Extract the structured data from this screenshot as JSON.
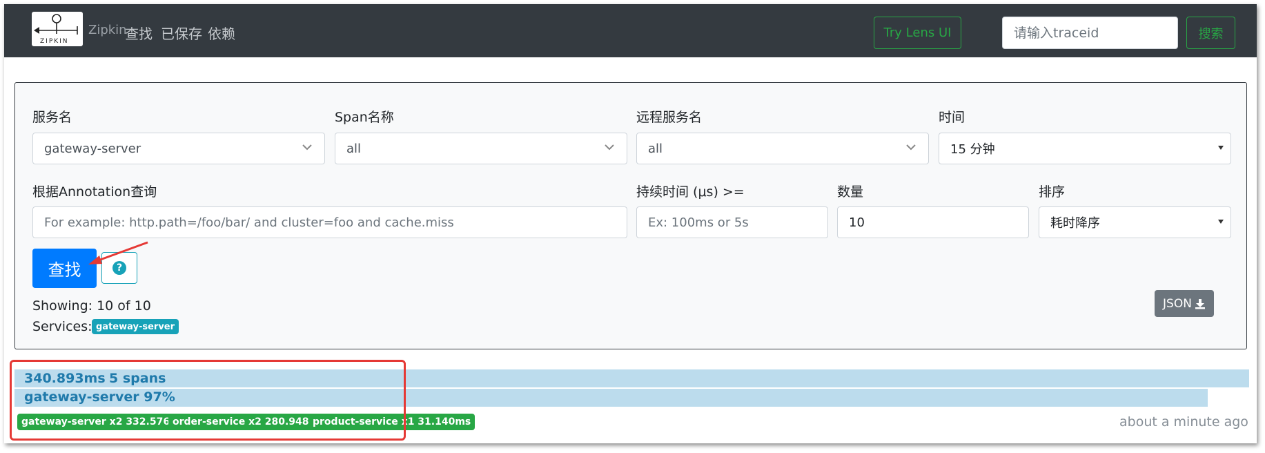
{
  "navbar": {
    "logo_text": "ZIPKIN",
    "brand": "Zipkin",
    "links": [
      "查找",
      "已保存",
      "依赖"
    ],
    "try_lens_label": "Try Lens UI",
    "traceid_placeholder": "请输入traceid",
    "search_label": "搜索"
  },
  "search_form": {
    "service_label": "服务名",
    "service_value": "gateway-server",
    "span_label": "Span名称",
    "span_value": "all",
    "remote_label": "远程服务名",
    "remote_value": "all",
    "time_label": "时间",
    "time_value": "15 分钟",
    "annotation_label": "根据Annotation查询",
    "annotation_placeholder": "For example: http.path=/foo/bar/ and cluster=foo and cache.miss",
    "duration_label": "持续时间 (μs) >=",
    "duration_placeholder": "Ex: 100ms or 5s",
    "limit_label": "数量",
    "limit_value": "10",
    "sort_label": "排序",
    "sort_value": "耗时降序",
    "find_label": "查找",
    "help_icon": "question-icon",
    "showing": "Showing: 10 of 10",
    "services_label": "Services:",
    "services_badge": "gateway-server",
    "json_label": "JSON",
    "json_icon": "download-icon"
  },
  "result": {
    "duration": "340.893ms",
    "spans": "5 spans",
    "service_percent": "gateway-server 97%",
    "percent_value": 97,
    "tags": [
      "gateway-server x2 332.576ms",
      "order-service x2 280.948ms",
      "product-service x1 31.140ms"
    ],
    "time_ago": "about a minute ago"
  },
  "colors": {
    "navbar": "#343a40",
    "primary": "#007bff",
    "success": "#28a745",
    "info": "#17a2b8",
    "bar": "#bcdced",
    "annotation": "#e53935"
  }
}
